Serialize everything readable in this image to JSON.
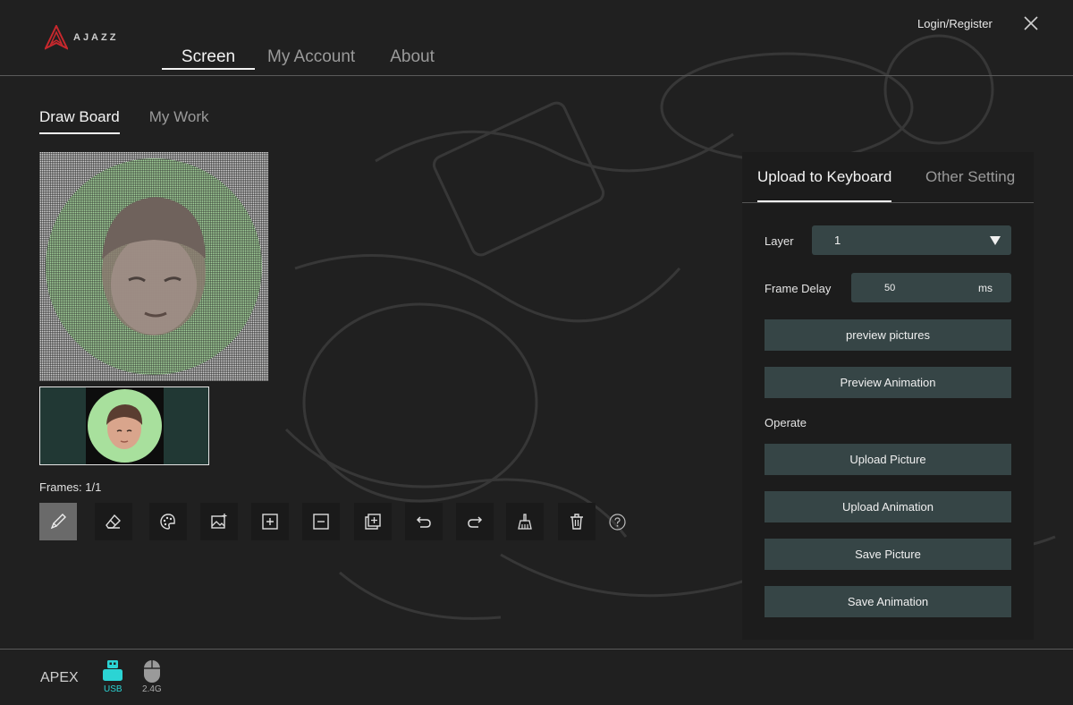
{
  "app": {
    "logo_text": "AJAZZ",
    "login_label": "Login/Register"
  },
  "nav": {
    "tabs": [
      {
        "label": "Screen",
        "active": true
      },
      {
        "label": "My Account",
        "active": false
      },
      {
        "label": "About",
        "active": false
      }
    ]
  },
  "subtabs": {
    "draw_board": "Draw Board",
    "my_work": "My Work"
  },
  "frames": "Frames: 1/1",
  "toolbar": {
    "tools": [
      "brush-icon",
      "eraser-icon",
      "palette-icon",
      "image-icon",
      "add-frame-icon",
      "remove-frame-icon",
      "copy-frame-icon",
      "undo-icon",
      "redo-icon",
      "clean-brush-icon",
      "trash-icon"
    ],
    "help_icon": "help-icon"
  },
  "panel": {
    "tabs": {
      "upload": "Upload to Keyboard",
      "other": "Other Setting"
    },
    "layer": {
      "label": "Layer",
      "value": "1"
    },
    "frame_delay": {
      "label": "Frame Delay",
      "value": "50",
      "unit": "ms"
    },
    "preview_pictures": "preview pictures",
    "preview_animation": "Preview Animation",
    "operate_label": "Operate",
    "upload_picture": "Upload Picture",
    "upload_animation": "Upload Animation",
    "save_picture": "Save Picture",
    "save_animation": "Save Animation"
  },
  "footer": {
    "device": "APEX",
    "usb_label": "USB",
    "wireless_label": "2.4G"
  },
  "colors": {
    "accent": "#2bd4d4",
    "button_bg": "#364546",
    "logo_red": "#c8282d",
    "thumb_bg": "#213834"
  }
}
